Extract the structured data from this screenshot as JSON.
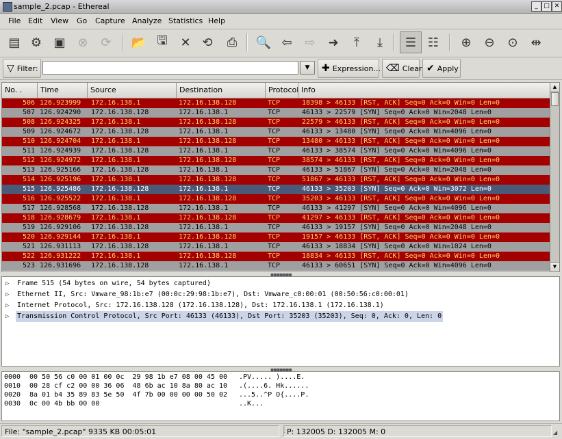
{
  "window": {
    "title": "sample_2.pcap - Ethereal",
    "controls": [
      "_",
      "□",
      "✕"
    ]
  },
  "menubar": [
    "File",
    "Edit",
    "View",
    "Go",
    "Capture",
    "Analyze",
    "Statistics",
    "Help"
  ],
  "toolbar": {
    "icons": [
      {
        "name": "interfaces-icon",
        "glyph": "▤",
        "disabled": false
      },
      {
        "name": "capture-options-icon",
        "glyph": "⚙",
        "disabled": false
      },
      {
        "name": "start-capture-icon",
        "glyph": "▣",
        "disabled": false
      },
      {
        "name": "stop-capture-icon",
        "glyph": "⊗",
        "disabled": true
      },
      {
        "name": "restart-capture-icon",
        "glyph": "⟳",
        "disabled": true
      },
      {
        "name": "open-file-icon",
        "glyph": "📂",
        "disabled": false
      },
      {
        "name": "save-file-icon",
        "glyph": "🖫",
        "disabled": false
      },
      {
        "name": "close-file-icon",
        "glyph": "✕",
        "disabled": false
      },
      {
        "name": "reload-icon",
        "glyph": "⟲",
        "disabled": false
      },
      {
        "name": "print-icon",
        "glyph": "⎙",
        "disabled": false
      },
      {
        "name": "find-packet-icon",
        "glyph": "🔍",
        "disabled": false
      },
      {
        "name": "go-back-icon",
        "glyph": "⇦",
        "disabled": false
      },
      {
        "name": "go-forward-icon",
        "glyph": "⇨",
        "disabled": true
      },
      {
        "name": "go-to-packet-icon",
        "glyph": "➜",
        "disabled": false
      },
      {
        "name": "go-first-icon",
        "glyph": "⤒",
        "disabled": false
      },
      {
        "name": "go-last-icon",
        "glyph": "⤓",
        "disabled": false
      },
      {
        "name": "colorize-icon",
        "glyph": "☰",
        "disabled": false
      },
      {
        "name": "auto-scroll-icon",
        "glyph": "☷",
        "disabled": false
      },
      {
        "name": "zoom-in-icon",
        "glyph": "⊕",
        "disabled": false
      },
      {
        "name": "zoom-out-icon",
        "glyph": "⊖",
        "disabled": false
      },
      {
        "name": "zoom-normal-icon",
        "glyph": "⊙",
        "disabled": false
      },
      {
        "name": "resize-columns-icon",
        "glyph": "⇹",
        "disabled": false
      }
    ]
  },
  "filter": {
    "label": "Filter:",
    "value": "",
    "expression_label": "Expression...",
    "clear_label": "Clear",
    "apply_label": "Apply"
  },
  "packet_list": {
    "columns": [
      "No. .",
      "Time",
      "Source",
      "Destination",
      "Protocol",
      "Info"
    ],
    "rows": [
      {
        "no": "506",
        "time": "126.923999",
        "src": "172.16.138.1",
        "dst": "172.16.138.128",
        "proto": "TCP",
        "info": "18398 > 46133 [RST, ACK] Seq=0 Ack=0 Win=0 Len=0",
        "kind": "rst"
      },
      {
        "no": "507",
        "time": "126.924290",
        "src": "172.16.138.128",
        "dst": "172.16.138.1",
        "proto": "TCP",
        "info": "46133 > 22579 [SYN] Seq=0 Ack=0 Win=2048 Len=0",
        "kind": "syn"
      },
      {
        "no": "508",
        "time": "126.924325",
        "src": "172.16.138.1",
        "dst": "172.16.138.128",
        "proto": "TCP",
        "info": "22579 > 46133 [RST, ACK] Seq=0 Ack=0 Win=0 Len=0",
        "kind": "rst"
      },
      {
        "no": "509",
        "time": "126.924672",
        "src": "172.16.138.128",
        "dst": "172.16.138.1",
        "proto": "TCP",
        "info": "46133 > 13480 [SYN] Seq=0 Ack=0 Win=4096 Len=0",
        "kind": "syn"
      },
      {
        "no": "510",
        "time": "126.924704",
        "src": "172.16.138.1",
        "dst": "172.16.138.128",
        "proto": "TCP",
        "info": "13480 > 46133 [RST, ACK] Seq=0 Ack=0 Win=0 Len=0",
        "kind": "rst"
      },
      {
        "no": "511",
        "time": "126.924939",
        "src": "172.16.138.128",
        "dst": "172.16.138.1",
        "proto": "TCP",
        "info": "46133 > 38574 [SYN] Seq=0 Ack=0 Win=4096 Len=0",
        "kind": "syn"
      },
      {
        "no": "512",
        "time": "126.924972",
        "src": "172.16.138.1",
        "dst": "172.16.138.128",
        "proto": "TCP",
        "info": "38574 > 46133 [RST, ACK] Seq=0 Ack=0 Win=0 Len=0",
        "kind": "rst"
      },
      {
        "no": "513",
        "time": "126.925166",
        "src": "172.16.138.128",
        "dst": "172.16.138.1",
        "proto": "TCP",
        "info": "46133 > 51867 [SYN] Seq=0 Ack=0 Win=2048 Len=0",
        "kind": "syn"
      },
      {
        "no": "514",
        "time": "126.925196",
        "src": "172.16.138.1",
        "dst": "172.16.138.128",
        "proto": "TCP",
        "info": "51867 > 46133 [RST, ACK] Seq=0 Ack=0 Win=0 Len=0",
        "kind": "rst"
      },
      {
        "no": "515",
        "time": "126.925486",
        "src": "172.16.138.128",
        "dst": "172.16.138.1",
        "proto": "TCP",
        "info": "46133 > 35203 [SYN] Seq=0 Ack=0 Win=3072 Len=0",
        "kind": "sel"
      },
      {
        "no": "516",
        "time": "126.925522",
        "src": "172.16.138.1",
        "dst": "172.16.138.128",
        "proto": "TCP",
        "info": "35203 > 46133 [RST, ACK] Seq=0 Ack=0 Win=0 Len=0",
        "kind": "rst"
      },
      {
        "no": "517",
        "time": "126.928568",
        "src": "172.16.138.128",
        "dst": "172.16.138.1",
        "proto": "TCP",
        "info": "46133 > 41297 [SYN] Seq=0 Ack=0 Win=4096 Len=0",
        "kind": "syn"
      },
      {
        "no": "518",
        "time": "126.928679",
        "src": "172.16.138.1",
        "dst": "172.16.138.128",
        "proto": "TCP",
        "info": "41297 > 46133 [RST, ACK] Seq=0 Ack=0 Win=0 Len=0",
        "kind": "rst"
      },
      {
        "no": "519",
        "time": "126.929106",
        "src": "172.16.138.128",
        "dst": "172.16.138.1",
        "proto": "TCP",
        "info": "46133 > 19157 [SYN] Seq=0 Ack=0 Win=2048 Len=0",
        "kind": "syn"
      },
      {
        "no": "520",
        "time": "126.929144",
        "src": "172.16.138.1",
        "dst": "172.16.138.128",
        "proto": "TCP",
        "info": "19157 > 46133 [RST, ACK] Seq=0 Ack=0 Win=0 Len=0",
        "kind": "rst"
      },
      {
        "no": "521",
        "time": "126.931113",
        "src": "172.16.138.128",
        "dst": "172.16.138.1",
        "proto": "TCP",
        "info": "46133 > 18834 [SYN] Seq=0 Ack=0 Win=1024 Len=0",
        "kind": "syn"
      },
      {
        "no": "522",
        "time": "126.931222",
        "src": "172.16.138.1",
        "dst": "172.16.138.128",
        "proto": "TCP",
        "info": "18834 > 46133 [RST, ACK] Seq=0 Ack=0 Win=0 Len=0",
        "kind": "rst"
      },
      {
        "no": "523",
        "time": "126.931696",
        "src": "172.16.138.128",
        "dst": "172.16.138.1",
        "proto": "TCP",
        "info": "46133 > 60651 [SYN] Seq=0 Ack=0 Win=4096 Len=0",
        "kind": "syn"
      }
    ]
  },
  "details": [
    {
      "text": "Frame 515 (54 bytes on wire, 54 bytes captured)",
      "selected": false
    },
    {
      "text": "Ethernet II, Src: Vmware_98:1b:e7 (00:0c:29:98:1b:e7), Dst: Vmware_c0:00:01 (00:50:56:c0:00:01)",
      "selected": false
    },
    {
      "text": "Internet Protocol, Src: 172.16.138.128 (172.16.138.128), Dst: 172.16.138.1 (172.16.138.1)",
      "selected": false
    },
    {
      "text": "Transmission Control Protocol, Src Port: 46133 (46133), Dst Port: 35203 (35203), Seq: 0, Ack: 0, Len: 0",
      "selected": true
    }
  ],
  "hex_dump": [
    {
      "offset": "0000",
      "bytes": "00 50 56 c0 00 01 00 0c  29 98 1b e7 08 00 45 00",
      "ascii": ".PV..... )....E."
    },
    {
      "offset": "0010",
      "bytes": "00 28 cf c2 00 00 36 06  48 6b ac 10 8a 80 ac 10",
      "ascii": ".(....6. Hk......"
    },
    {
      "offset": "0020",
      "bytes": "8a 01 b4 35 89 83 5e 50  4f 7b 00 00 00 00 50 02",
      "ascii": "...5..^P O{....P."
    },
    {
      "offset": "0030",
      "bytes": "0c 00 4b bb 00 00",
      "ascii": "..K..."
    }
  ],
  "status": {
    "file": "File: \"sample_2.pcap\" 9335 KB 00:05:01",
    "counts": "P: 132005 D: 132005 M: 0"
  },
  "colors": {
    "rst_bg": "#a40000",
    "rst_fg": "#ffd36e",
    "syn_bg": "#a0a0a0",
    "selected_bg": "#4a5a78"
  }
}
